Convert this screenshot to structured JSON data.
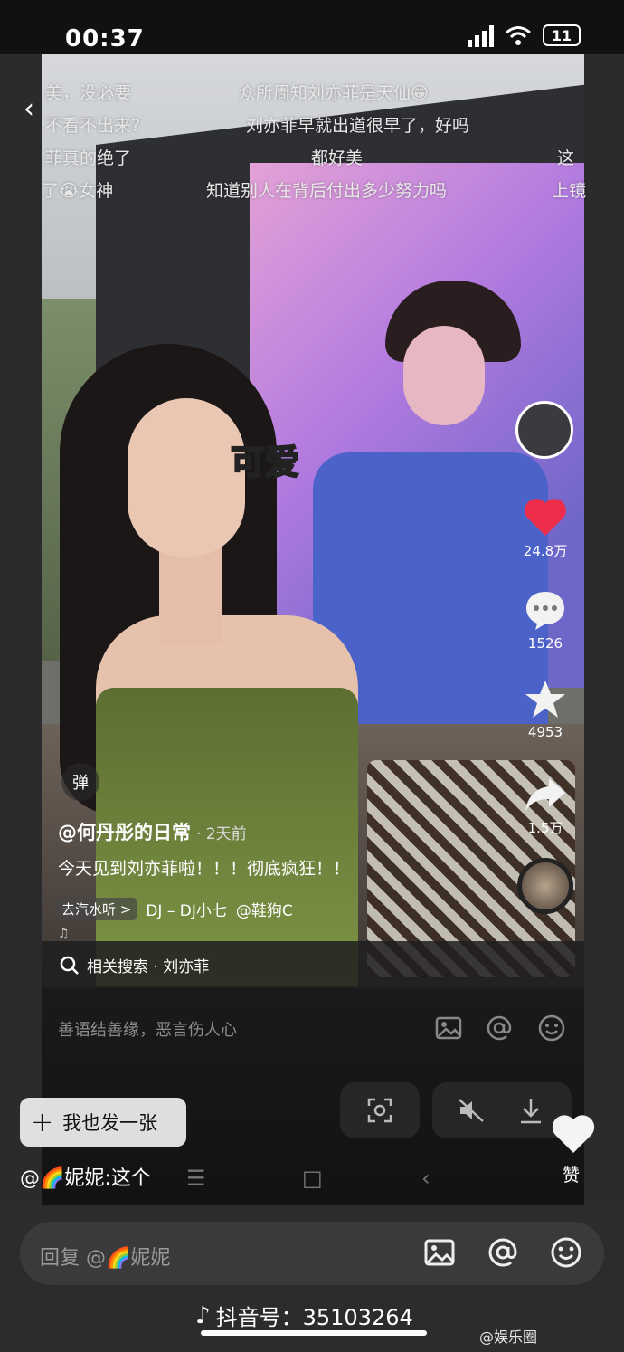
{
  "status_bar": {
    "timer": "00:37",
    "battery": "11"
  },
  "danmaku": [
    "美，没必要",
    "众所周知刘亦菲是天仙😁",
    "不看不出来?",
    "刘亦菲早就出道很早了，好吗",
    "菲真的绝了",
    "都好美",
    "这",
    "了😭女神",
    "知道别人在背后付出多少努力吗",
    "上镜"
  ],
  "sticker_text": "可爱",
  "actions": {
    "likes": "24.8万",
    "comments": "1526",
    "favorites": "4953",
    "shares": "1.5万"
  },
  "post": {
    "danmaku_button": "弹",
    "author": "@何丹彤的日常",
    "time": "· 2天前",
    "caption": "今天见到刘亦菲啦！！！彻底疯狂！！",
    "music_tag": "去汽水听 >",
    "music": "DJ – DJ小七",
    "music_author": "@鞋狗C",
    "related_search": "相关搜索 · 刘亦菲"
  },
  "composer": {
    "hint": "善语结善缘，恶言伤人心",
    "post_button": "我也发一张",
    "reply_line": "@🌈妮妮:这个"
  },
  "like_label": "赞",
  "reply_bar": {
    "placeholder": "回复 @🌈妮妮"
  },
  "douyin_id": "抖音号：35103264",
  "watermark": "@娱乐圈"
}
